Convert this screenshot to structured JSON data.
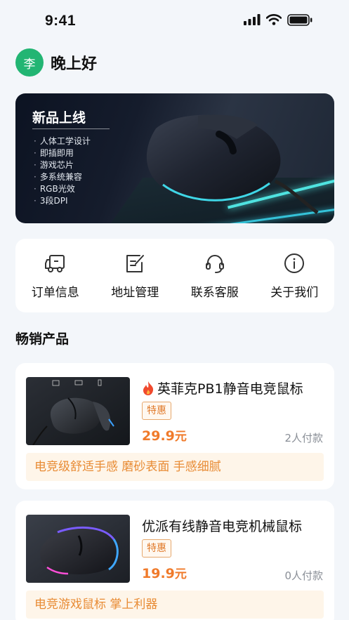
{
  "status_bar": {
    "time": "9:41"
  },
  "greeting": {
    "avatar_text": "李",
    "text": "晚上好"
  },
  "banner": {
    "title": "新品上线",
    "features": [
      "人体工学设计",
      "即插即用",
      "游戏芯片",
      "多系统兼容",
      "RGB光效",
      "3段DPI"
    ]
  },
  "menu": [
    {
      "label": "订单信息",
      "icon": "truck-icon"
    },
    {
      "label": "地址管理",
      "icon": "edit-note-icon"
    },
    {
      "label": "联系客服",
      "icon": "headset-icon"
    },
    {
      "label": "关于我们",
      "icon": "info-icon"
    }
  ],
  "section": {
    "title": "畅销产品"
  },
  "products": [
    {
      "name": "英菲克PB1静音电竞鼠标",
      "hot_icon": "fire-icon",
      "tag": "特惠",
      "price": "29.9",
      "price_unit": "元",
      "paid": "2人付款",
      "desc": "电竞级舒适手感 磨砂表面 手感细腻"
    },
    {
      "name": "优派有线静音电竞机械鼠标",
      "tag": "特惠",
      "price": "19.9",
      "price_unit": "元",
      "paid": "0人付款",
      "desc": "电竞游戏鼠标 掌上利器"
    }
  ],
  "colors": {
    "accent_orange": "#f07a2a",
    "avatar_green": "#22b573",
    "page_bg": "#f3f6fa"
  }
}
